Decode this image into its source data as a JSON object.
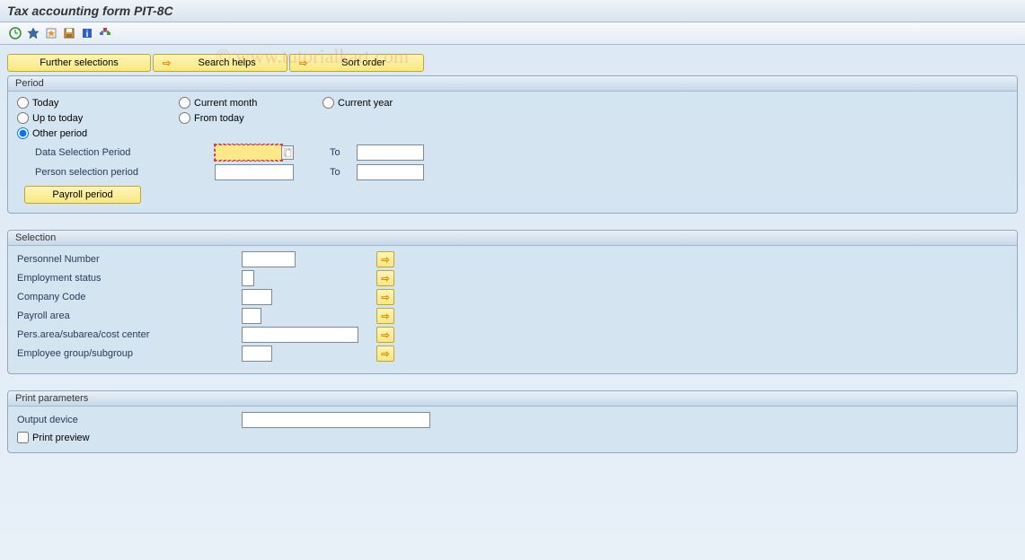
{
  "title": "Tax accounting form PIT-8C",
  "buttons": {
    "further_selections": "Further selections",
    "search_helps": "Search helps",
    "sort_order": "Sort order",
    "payroll_period": "Payroll period"
  },
  "panels": {
    "period": {
      "title": "Period",
      "radios": {
        "today": "Today",
        "current_month": "Current month",
        "current_year": "Current year",
        "up_to_today": "Up to today",
        "from_today": "From today",
        "other_period": "Other period"
      },
      "data_selection_label": "Data Selection Period",
      "data_selection_from": "",
      "data_selection_to": "",
      "person_selection_label": "Person selection period",
      "person_selection_from": "",
      "person_selection_to": "",
      "to_label": "To"
    },
    "selection": {
      "title": "Selection",
      "rows": {
        "personnel_number": "Personnel Number",
        "employment_status": "Employment status",
        "company_code": "Company Code",
        "payroll_area": "Payroll area",
        "pers_area": "Pers.area/subarea/cost center",
        "employee_group": "Employee group/subgroup"
      }
    },
    "print": {
      "title": "Print parameters",
      "output_device_label": "Output device",
      "output_device_value": "",
      "print_preview_label": "Print preview"
    }
  },
  "watermark": "© www.tutorialkart.com"
}
